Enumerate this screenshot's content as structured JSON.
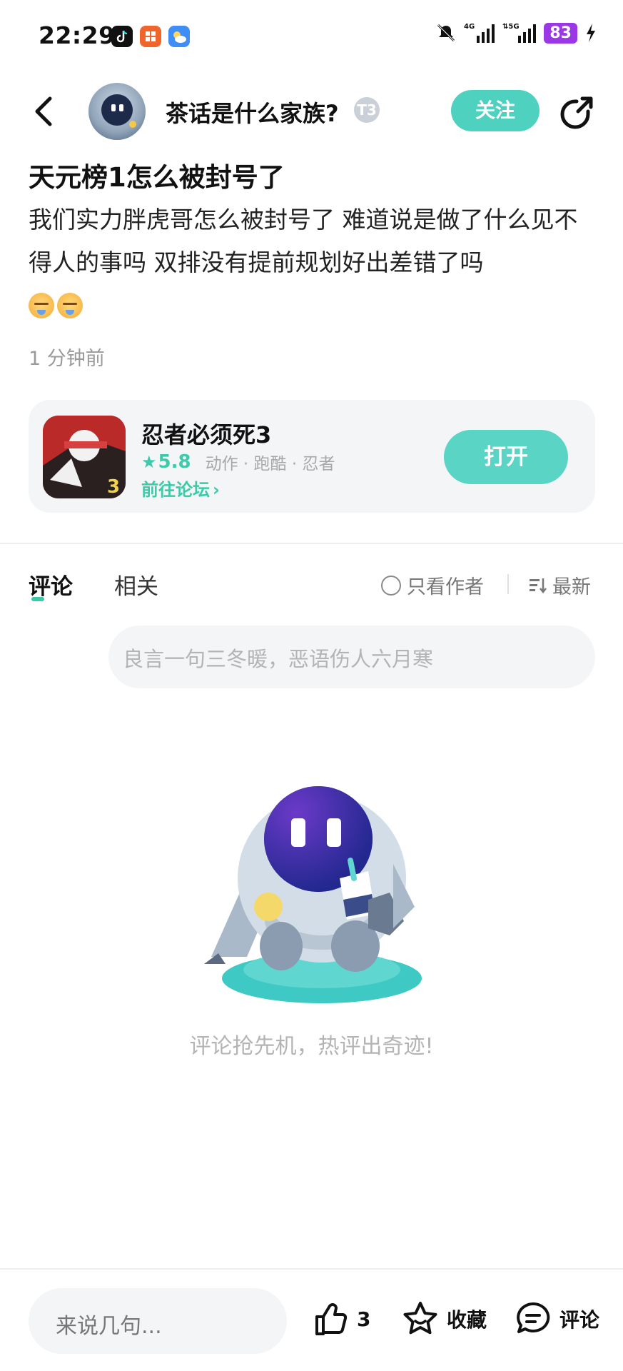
{
  "status_bar": {
    "time": "22:29",
    "network_1": "4G",
    "network_2": "5G",
    "battery": "83"
  },
  "header": {
    "author_name": "茶话是什么家族?",
    "level_badge": "T3",
    "follow_label": "关注"
  },
  "post": {
    "title": "天元榜1怎么被封号了",
    "body": "我们实力胖虎哥怎么被封号了 难道说是做了什么见不得人的事吗 双排没有提前规划好出差错了吗",
    "time": "1 分钟前"
  },
  "game_card": {
    "name": "忍者必须死3",
    "rating": "5.8",
    "tags": "动作 · 跑酷 · 忍者",
    "forum_link": "前往论坛",
    "open_label": "打开"
  },
  "comments": {
    "tabs": [
      "评论",
      "相关"
    ],
    "author_only": "只看作者",
    "sort": "最新",
    "input_placeholder": "良言一句三冬暖，恶语伤人六月寒",
    "empty_text": "评论抢先机，热评出奇迹!"
  },
  "bottom_bar": {
    "input_placeholder": "来说几句...",
    "like_count": "3",
    "favorite_label": "收藏",
    "comment_label": "评论"
  },
  "colors": {
    "accent": "#4fd1c0",
    "battery": "#9b38e6",
    "muted_text": "#9a9a9a"
  },
  "icons": [
    "back-icon",
    "share-icon",
    "star-icon",
    "chevron-right-icon",
    "radio-icon",
    "sort-icon",
    "thumbs-up-icon",
    "star-outline-icon",
    "comment-bubble-icon"
  ]
}
